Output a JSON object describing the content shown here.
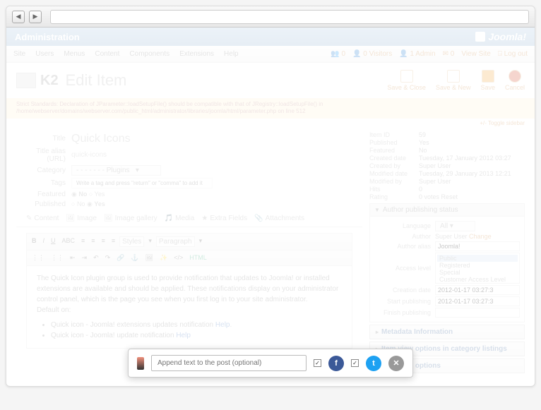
{
  "admin": {
    "title": "Administration",
    "brand": "Joomla!"
  },
  "menu": {
    "items": [
      "Site",
      "Users",
      "Menus",
      "Content",
      "Components",
      "Extensions",
      "Help"
    ],
    "status": {
      "users": "0",
      "visitors": "0 Visitors",
      "admin": "1 Admin",
      "msgs": "0",
      "viewsite": "View Site",
      "logout": "Log out"
    }
  },
  "page": {
    "k2": "K2",
    "title": "Edit Item"
  },
  "toolbar": {
    "saveclose": "Save & Close",
    "savenew": "Save & New",
    "save": "Save",
    "cancel": "Cancel"
  },
  "warning": "Strict Standards: Declaration of JParameter::loadSetupFile() should be compatible with that of JRegistry::loadSetupFile() in /home/webserver/domains/webserver.com/public_html/administrator/libraries/joomla/html/parameter.php on line 512",
  "toggle": "+/- Toggle sidebar",
  "form": {
    "title_lbl": "Title",
    "title": "Quick Icons",
    "alias_lbl": "Title alias (URL)",
    "alias": "quick-icons",
    "cat_lbl": "Category",
    "cat": "- - - - - - - Plugins",
    "tags_lbl": "Tags",
    "tags_ph": "Write a tag and press \"return\" or \"comma\" to add it",
    "featured_lbl": "Featured",
    "published_lbl": "Published",
    "no": "No",
    "yes": "Yes"
  },
  "meta": {
    "rows": [
      {
        "l": "Item ID",
        "v": "59"
      },
      {
        "l": "Published",
        "v": "Yes"
      },
      {
        "l": "Featured",
        "v": "No"
      },
      {
        "l": "Created date",
        "v": "Tuesday, 17 January 2012 03:27"
      },
      {
        "l": "Created by",
        "v": "Super User"
      },
      {
        "l": "Modified date",
        "v": "Tuesday, 29 January 2013 12:21"
      },
      {
        "l": "Modified by",
        "v": "Super User"
      },
      {
        "l": "Hits",
        "v": "0"
      },
      {
        "l": "Rating",
        "v": "0 votes  Reset"
      }
    ]
  },
  "author": {
    "head": "Author publishing status",
    "lang_lbl": "Language",
    "lang": "All",
    "author_lbl": "Author",
    "author": "Super User",
    "change": "Change",
    "alias_lbl": "Author alias",
    "alias": "Joomla!",
    "access_lbl": "Access level",
    "levels": [
      "Public",
      "Registered",
      "Special",
      "Customer Access Level (Example)"
    ],
    "creation_lbl": "Creation date",
    "creation": "2012-01-17 03:27:3",
    "start_lbl": "Start publishing",
    "start": "2012-01-17 03:27:3",
    "finish_lbl": "Finish publishing",
    "finish": ""
  },
  "accordions": [
    "Metadata Information",
    "Item view options in category listings",
    "Item view options"
  ],
  "tabs": [
    "Content",
    "Image",
    "Image gallery",
    "Media",
    "Extra Fields",
    "Attachments"
  ],
  "editor": {
    "styles": "Styles",
    "para": "Paragraph",
    "body": "The Quick Icon plugin group is used to provide notification that updates to Joomla! or installed extensions are available and should be applied. These notifications display on your administrator control panel, which is the page you see when you first log in to your site administrator.",
    "default": "Default on:",
    "li1a": "Quick icon - Joomla! extensions updates notification ",
    "li1b": "Help",
    "li2a": "Quick icon - Joomla! update notification ",
    "li2b": "Help"
  },
  "share": {
    "placeholder": "Append text to the post (optional)"
  }
}
